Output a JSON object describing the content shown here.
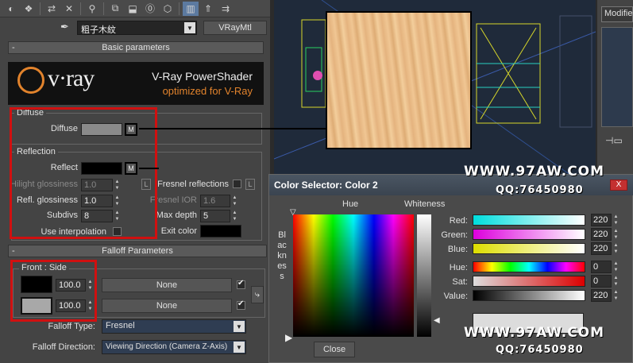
{
  "toolbar": {
    "icons": [
      "sphere-icon",
      "sample-icon",
      "put-icon",
      "reset-icon",
      "assign-icon",
      "copy-icon",
      "unique-icon",
      "effect-icon",
      "video-icon",
      "show-map-icon",
      "show-end-icon",
      "go-parent-icon",
      "go-sibling-icon"
    ]
  },
  "material": {
    "name": "粗子木紋",
    "type": "VRayMtl"
  },
  "basic": {
    "title": "Basic parameters",
    "logo_text": "v·ray",
    "product_title": "V-Ray PowerShader",
    "product_sub": "optimized for V-Ray",
    "diffuse_group": "Diffuse",
    "diffuse_label": "Diffuse",
    "m_label": "M",
    "reflection_group": "Reflection",
    "reflect_label": "Reflect",
    "hilight_label": "Hilight glossiness",
    "hilight_value": "1.0",
    "refl_gloss_label": "Refl. glossiness",
    "refl_gloss_value": "1.0",
    "subdivs_label": "Subdivs",
    "subdivs_value": "8",
    "use_interp_label": "Use interpolation",
    "fresnel_label": "Fresnel reflections",
    "fresnel_ior_label": "Fresnel IOR",
    "fresnel_ior_value": "1.6",
    "max_depth_label": "Max depth",
    "max_depth_value": "5",
    "exit_color_label": "Exit color",
    "l_label": "L"
  },
  "falloff": {
    "title": "Falloff Parameters",
    "group": "Front : Side",
    "value1": "100.0",
    "value2": "100.0",
    "none1": "None",
    "none2": "None",
    "type_label": "Falloff Type:",
    "type_value": "Fresnel",
    "dir_label": "Falloff Direction:",
    "dir_value": "Viewing Direction (Camera Z-Axis)"
  },
  "modifier": {
    "tab_label": "Modifie"
  },
  "color_selector": {
    "title": "Color Selector: Color 2",
    "close_x": "X",
    "hue_label": "Hue",
    "whiteness_label": "Whiteness",
    "blackness_label": "Blackness",
    "red_label": "Red:",
    "red_value": "220",
    "green_label": "Green:",
    "green_value": "220",
    "blue_label": "Blue:",
    "blue_value": "220",
    "hue2_label": "Hue:",
    "hue2_value": "0",
    "sat_label": "Sat:",
    "sat_value": "0",
    "value_label": "Value:",
    "value_value": "220",
    "close_button": "Close"
  },
  "watermark": {
    "site1": "WWW.97AW.COM",
    "qq1": "QQ:76450980",
    "site2": "WWW.97AW.COM",
    "qq2": "QQ:76450980"
  },
  "colors": {
    "accent": "#e2832c",
    "highlight": "#d01010",
    "preview": "#dcdcdc"
  }
}
